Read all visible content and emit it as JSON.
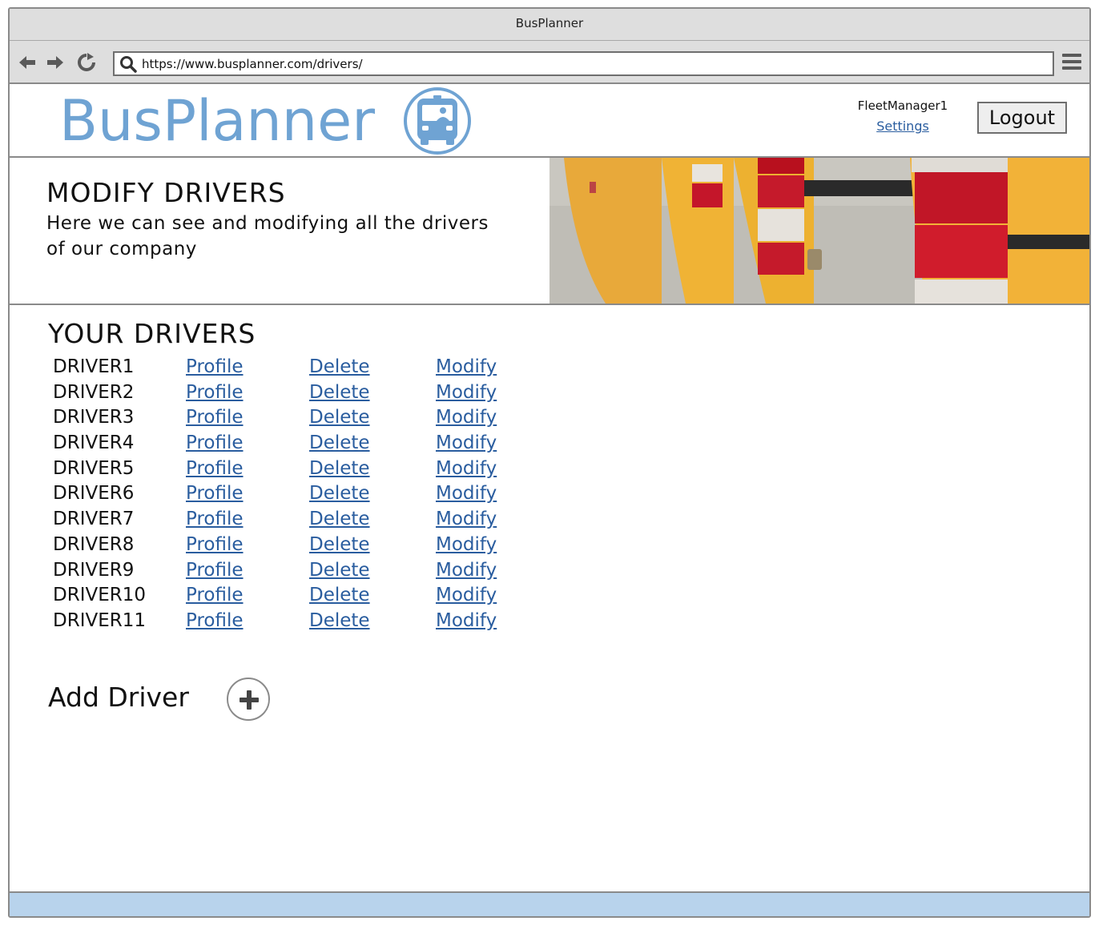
{
  "window": {
    "title": "BusPlanner"
  },
  "browser": {
    "url": "https://www.busplanner.com/drivers/",
    "icons": [
      "back-arrow-icon",
      "forward-arrow-icon",
      "reload-icon",
      "search-icon",
      "hamburger-menu-icon"
    ]
  },
  "header": {
    "logo_text": "BusPlanner",
    "username": "FleetManager1",
    "settings_label": "Settings",
    "logout_label": "Logout"
  },
  "hero": {
    "title": "MODIFY DRIVERS",
    "description": "Here we can see and modifying all the drivers of our company"
  },
  "drivers": {
    "title": "YOUR DRIVERS",
    "profile_label": "Profile",
    "delete_label": "Delete",
    "modify_label": "Modify",
    "rows": [
      {
        "name": "DRIVER1"
      },
      {
        "name": "DRIVER2"
      },
      {
        "name": "DRIVER3"
      },
      {
        "name": "DRIVER4"
      },
      {
        "name": "DRIVER5"
      },
      {
        "name": "DRIVER6"
      },
      {
        "name": "DRIVER7"
      },
      {
        "name": "DRIVER8"
      },
      {
        "name": "DRIVER9"
      },
      {
        "name": "DRIVER10"
      },
      {
        "name": "DRIVER11"
      }
    ]
  },
  "add_driver": {
    "label": "Add Driver"
  },
  "colors": {
    "accent": "#6fa3d3",
    "link": "#2a5d9f",
    "status_bar": "#b8d3ec",
    "chrome": "#dedede"
  }
}
